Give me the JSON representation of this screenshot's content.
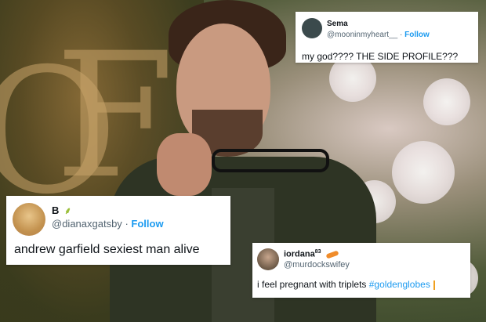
{
  "tweets": [
    {
      "name": "Sema",
      "handle": "@mooninmyheart__",
      "separator": "·",
      "follow_label": "Follow",
      "text": "my god???? THE SIDE PROFILE???"
    },
    {
      "name": "B",
      "badge_icon": "wheat-sprig-icon",
      "handle": "@dianaxgatsby",
      "separator": "·",
      "follow_label": "Follow",
      "text": "andrew garfield sexiest man alive"
    },
    {
      "name": "iordana",
      "name_superscript": "83",
      "badge_icon": "orange-pill-icon",
      "handle": "@murdockswifey",
      "text_plain": "i feel pregnant with triplets ",
      "hashtag": "#goldenglobes"
    }
  ],
  "colors": {
    "follow_blue": "#1d9bf0",
    "handle_gray": "#536471",
    "card_bg": "#ffffff"
  }
}
